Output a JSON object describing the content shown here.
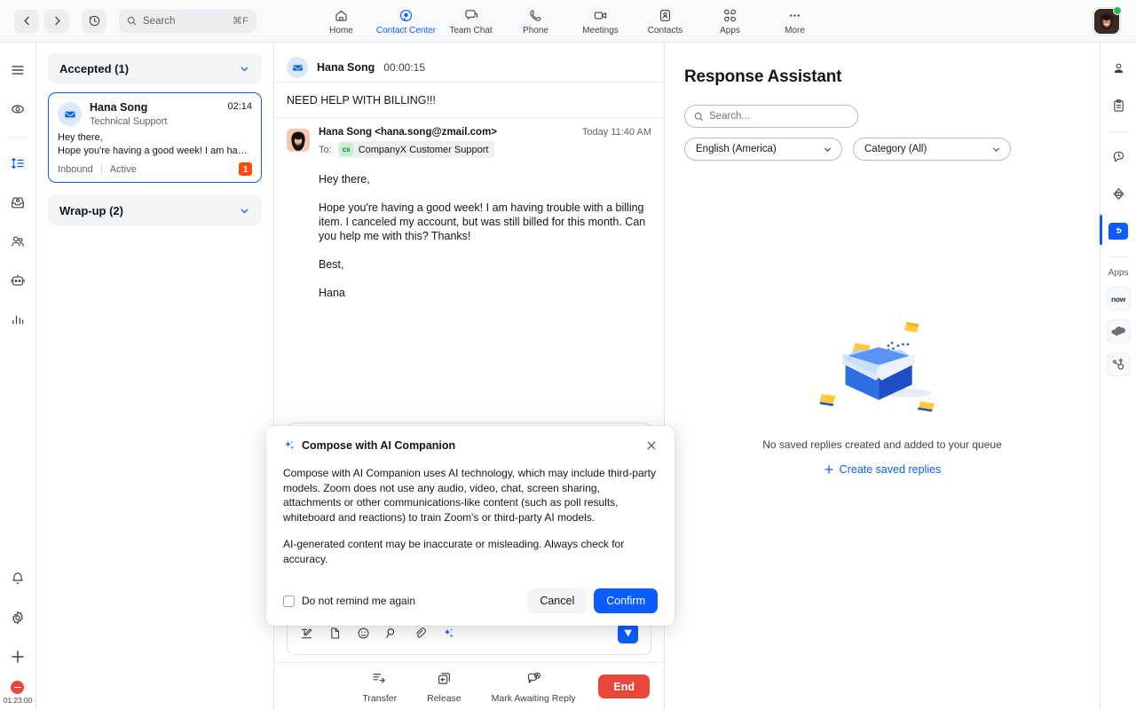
{
  "topbar": {
    "back_label": "‹",
    "forward_label": "›",
    "history_icon": "history-icon",
    "search": {
      "placeholder": "Search",
      "shortcut": "⌘F"
    },
    "nav": [
      {
        "label": "Home",
        "icon": "home-icon",
        "active": false
      },
      {
        "label": "Contact Center",
        "icon": "contact-center-icon",
        "active": true
      },
      {
        "label": "Team Chat",
        "icon": "team-chat-icon",
        "active": false
      },
      {
        "label": "Phone",
        "icon": "phone-icon",
        "active": false
      },
      {
        "label": "Meetings",
        "icon": "meetings-icon",
        "active": false
      },
      {
        "label": "Contacts",
        "icon": "contacts-icon",
        "active": false
      },
      {
        "label": "Apps",
        "icon": "apps-icon",
        "active": false
      },
      {
        "label": "More",
        "icon": "more-icon",
        "active": false
      }
    ],
    "avatar_name": "user-avatar",
    "presence": "available"
  },
  "leftrail": {
    "items": [
      {
        "icon": "hamburger-menu-icon",
        "active": false
      },
      {
        "icon": "engagement-icon",
        "active": false
      },
      {
        "icon": "queue-icon",
        "active": true
      },
      {
        "icon": "inbox-icon",
        "active": false
      },
      {
        "icon": "team-icon",
        "active": false
      },
      {
        "icon": "bot-icon",
        "active": false
      },
      {
        "icon": "analytics-icon",
        "active": false
      }
    ],
    "bottom": [
      {
        "icon": "bell-icon"
      },
      {
        "icon": "gear-icon"
      },
      {
        "icon": "plus-icon"
      }
    ],
    "status": {
      "state": "busy",
      "timer": "01:23:00"
    }
  },
  "conversations": {
    "groups": [
      {
        "title": "Accepted (1)",
        "expanded": true
      },
      {
        "title": "Wrap-up (2)",
        "expanded": false
      }
    ],
    "accepted": [
      {
        "name": "Hana Song",
        "queue": "Technical Support",
        "time": "02:14",
        "preview_line1": "Hey there,",
        "preview_line2": "Hope you're having a good week! I am having trou…",
        "direction": "Inbound",
        "state": "Active",
        "badge": "1",
        "channel_icon": "email-icon"
      }
    ]
  },
  "conversation": {
    "header": {
      "name": "Hana Song",
      "timer": "00:00:15",
      "channel_icon": "email-icon"
    },
    "subject": "NEED HELP WITH BILLING!!!",
    "message": {
      "from": "Hana Song <hana.song@zmail.com>",
      "to_label": "To:",
      "to_badge": "cs",
      "to_name": "CompanyX Customer Support",
      "date": "Today 11:40 AM",
      "paragraphs": [
        "Hey there,",
        "Hope you're having a good week! I am having trouble with a billing item. I canceled my account, but was still billed for this month. Can you help me with this? Thanks!",
        "Best,",
        "Hana"
      ]
    },
    "composer_tools": [
      {
        "icon": "format-text-icon"
      },
      {
        "icon": "file-icon"
      },
      {
        "icon": "emoji-icon"
      },
      {
        "icon": "search-icon"
      },
      {
        "icon": "attachment-icon"
      },
      {
        "icon": "ai-companion-sparkle-icon"
      }
    ],
    "send_icon": "send-icon",
    "actions": [
      {
        "label": "Transfer",
        "icon": "transfer-icon"
      },
      {
        "label": "Release",
        "icon": "release-icon"
      },
      {
        "label": "Mark Awaiting Reply",
        "icon": "awaiting-reply-icon"
      }
    ],
    "end_label": "End"
  },
  "response_assistant": {
    "title": "Response Assistant",
    "search_placeholder": "Search...",
    "language_value": "English (America)",
    "category_value": "Category (All)",
    "empty_text": "No saved replies created and added to your queue",
    "create_link": "Create saved replies"
  },
  "rightrail": {
    "items": [
      {
        "icon": "profile-icon",
        "active": false
      },
      {
        "icon": "notes-clipboard-icon",
        "active": false
      },
      {
        "icon": "engagement-history-icon",
        "active": false
      },
      {
        "icon": "knowledge-base-icon",
        "active": false
      },
      {
        "icon": "saved-replies-icon",
        "active": true
      }
    ],
    "apps_label": "Apps",
    "apps": [
      {
        "icon": "servicenow-app-icon",
        "label": "now"
      },
      {
        "icon": "salesforce-app-icon"
      },
      {
        "icon": "hubspot-app-icon"
      }
    ]
  },
  "modal": {
    "title": "Compose with AI Companion",
    "sparkle_icon": "ai-sparkle-icon",
    "close_icon": "close-icon",
    "paragraph1": "Compose with AI Companion uses AI technology, which may include third-party models. Zoom does not use any audio, video, chat, screen sharing, attachments or other communications-like content (such as poll results, whiteboard and reactions) to train Zoom's or third-party AI models.",
    "paragraph2": "AI-generated content may be inaccurate or misleading. Always check for accuracy.",
    "checkbox_label": "Do not remind me again",
    "cancel_label": "Cancel",
    "confirm_label": "Confirm"
  },
  "colors": {
    "accent": "#0b5cff",
    "danger": "#e8483b",
    "badge": "#ff4a0b",
    "presence_green": "#28bf4c"
  }
}
